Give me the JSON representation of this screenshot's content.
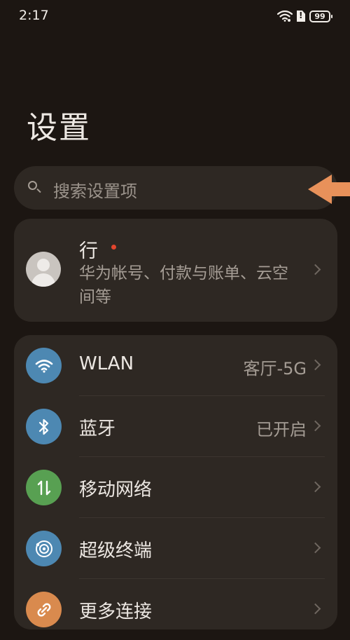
{
  "status_bar": {
    "time": "2:17",
    "battery_level": "99",
    "icons": [
      "wifi-icon",
      "sim-alert-icon",
      "battery-icon"
    ]
  },
  "page": {
    "title": "设置"
  },
  "search": {
    "placeholder": "搜索设置项"
  },
  "account": {
    "name": "行",
    "subtitle": "华为帐号、付款与账单、云空间等",
    "has_notification_dot": true
  },
  "settings": [
    {
      "label": "WLAN",
      "value": "客厅-5G",
      "icon": "wifi-icon",
      "color": "#4d88b2"
    },
    {
      "label": "蓝牙",
      "value": "已开启",
      "icon": "bluetooth-icon",
      "color": "#4d88b2"
    },
    {
      "label": "移动网络",
      "value": "",
      "icon": "mobile-data-icon",
      "color": "#58a052"
    },
    {
      "label": "超级终端",
      "value": "",
      "icon": "super-device-icon",
      "color": "#4d88b2"
    },
    {
      "label": "更多连接",
      "value": "",
      "icon": "more-connections-icon",
      "color": "#d98a4e"
    }
  ],
  "colors": {
    "background": "#1c1612",
    "card": "#2e2823",
    "arrow": "#e8915a",
    "notification_dot": "#e2452d"
  }
}
